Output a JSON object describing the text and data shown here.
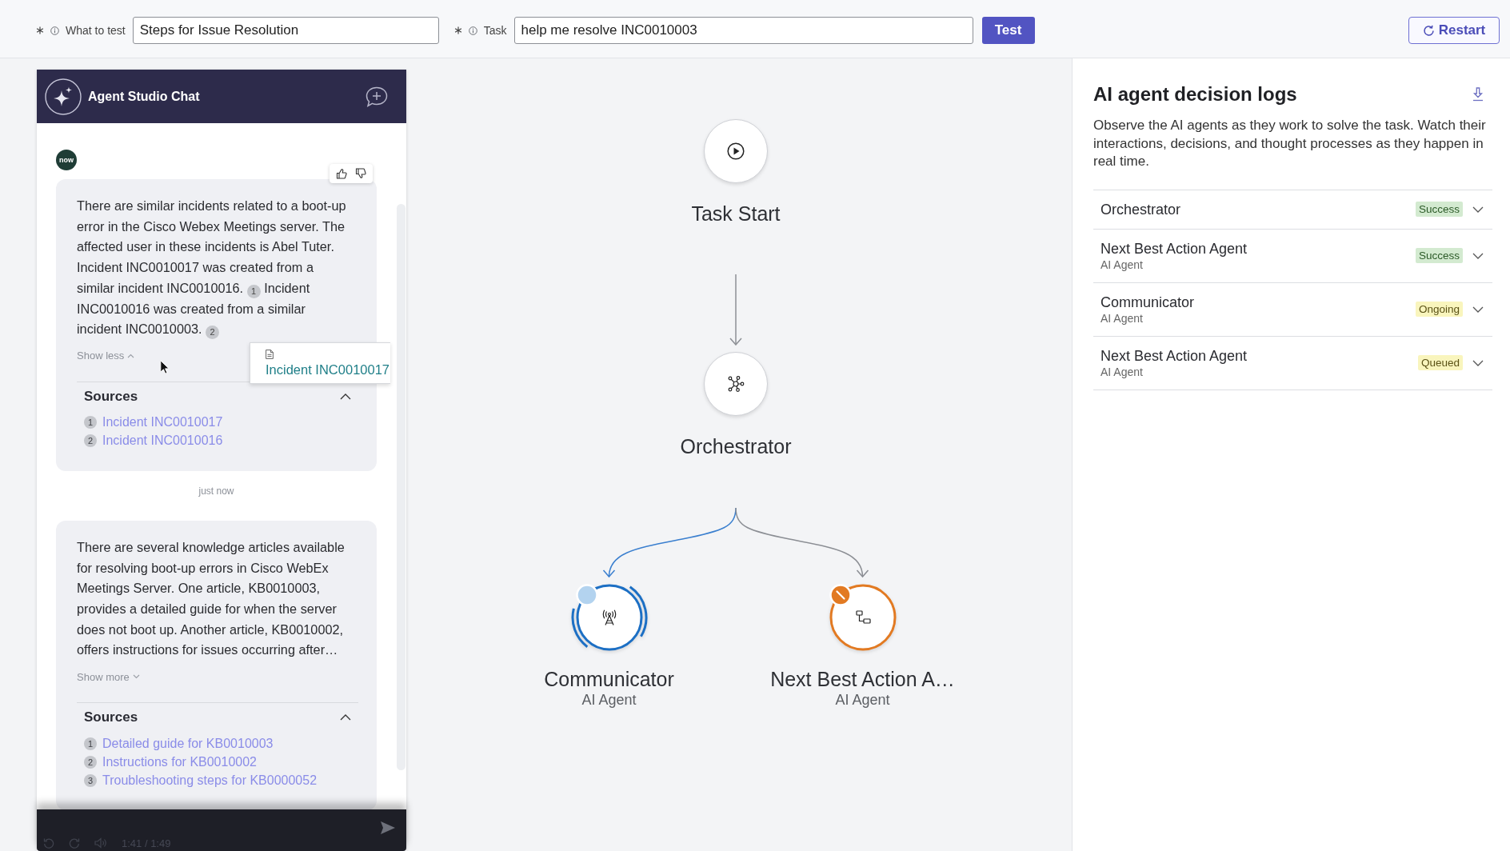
{
  "toolbar": {
    "fields": [
      {
        "label": "What to test",
        "required": true,
        "value": "Steps for Issue Resolution"
      },
      {
        "label": "Task",
        "required": true,
        "value": "help me resolve INC0010003"
      }
    ],
    "test_button": "Test",
    "restart_button": "Restart"
  },
  "chat": {
    "title": "Agent Studio Chat",
    "avatar": "now",
    "messages": [
      {
        "feedback": true,
        "segments": [
          {
            "kind": "text",
            "text": "There are similar incidents related to a boot-up error in the Cisco Webex Meetings server. The affected user in these incidents is Abel Tuter. Incident INC0010017 was created from a similar incident INC0010016. "
          },
          {
            "kind": "citation",
            "text": "1"
          },
          {
            "kind": "text",
            "text": " Incident INC0010016 was created from a similar incident INC0010003. "
          },
          {
            "kind": "citation",
            "text": "2"
          }
        ],
        "toggle": {
          "label": "Show less",
          "expanded": true
        },
        "popover": {
          "link": "Incident INC0010017"
        },
        "sources": {
          "title": "Sources",
          "expanded": true,
          "items": [
            {
              "number": "1",
              "title": "Incident INC0010017"
            },
            {
              "number": "2",
              "title": "Incident INC0010016"
            }
          ]
        },
        "time": "just now"
      },
      {
        "feedback": false,
        "segments": [
          {
            "kind": "text",
            "text": "There are several knowledge articles available for resolving boot-up errors in Cisco WebEx Meetings Server. One article, KB0010003, provides a detailed guide for when the server does not boot up. Another article, KB0010002, offers instructions for issues occurring after…"
          }
        ],
        "toggle": {
          "label": "Show more",
          "expanded": false
        },
        "sources": {
          "title": "Sources",
          "expanded": true,
          "items": [
            {
              "number": "1",
              "title": "Detailed guide for KB0010003"
            },
            {
              "number": "2",
              "title": "Instructions for KB0010002"
            },
            {
              "number": "3",
              "title": "Troubleshooting steps for KB0000052"
            }
          ]
        }
      }
    ],
    "composer": {
      "video_time": "1:41 / 1:49"
    }
  },
  "flow": {
    "nodes": [
      {
        "kind": "start",
        "label": "Task Start"
      },
      {
        "kind": "orchestrator",
        "label": "Orchestrator"
      }
    ],
    "agents": [
      {
        "kind": "communicator",
        "name": "Communicator",
        "subtitle": "AI Agent",
        "color": "#1c6fc4",
        "running": true
      },
      {
        "kind": "action",
        "name": "Next Best Action A…",
        "subtitle": "AI Agent",
        "color": "#e27a22",
        "running": false
      }
    ]
  },
  "decision_logs": {
    "title": "AI agent decision logs",
    "description": "Observe the AI agents as they work to solve the task. Watch their interactions, decisions, and thought processes as they happen in real time.",
    "entries": [
      {
        "name": "Orchestrator",
        "status": {
          "label": "Success",
          "kind": "success"
        },
        "expanded": false
      },
      {
        "name": "Next Best Action Agent",
        "subtitle": "AI Agent",
        "status": {
          "label": "Success",
          "kind": "success"
        },
        "expanded": false
      },
      {
        "name": "Communicator",
        "subtitle": "AI Agent",
        "status": {
          "label": "Ongoing",
          "kind": "ongoing"
        },
        "expanded": false
      },
      {
        "name": "Next Best Action Agent",
        "subtitle": "AI Agent",
        "status": {
          "label": "Queued",
          "kind": "queued"
        },
        "expanded": false
      }
    ]
  }
}
